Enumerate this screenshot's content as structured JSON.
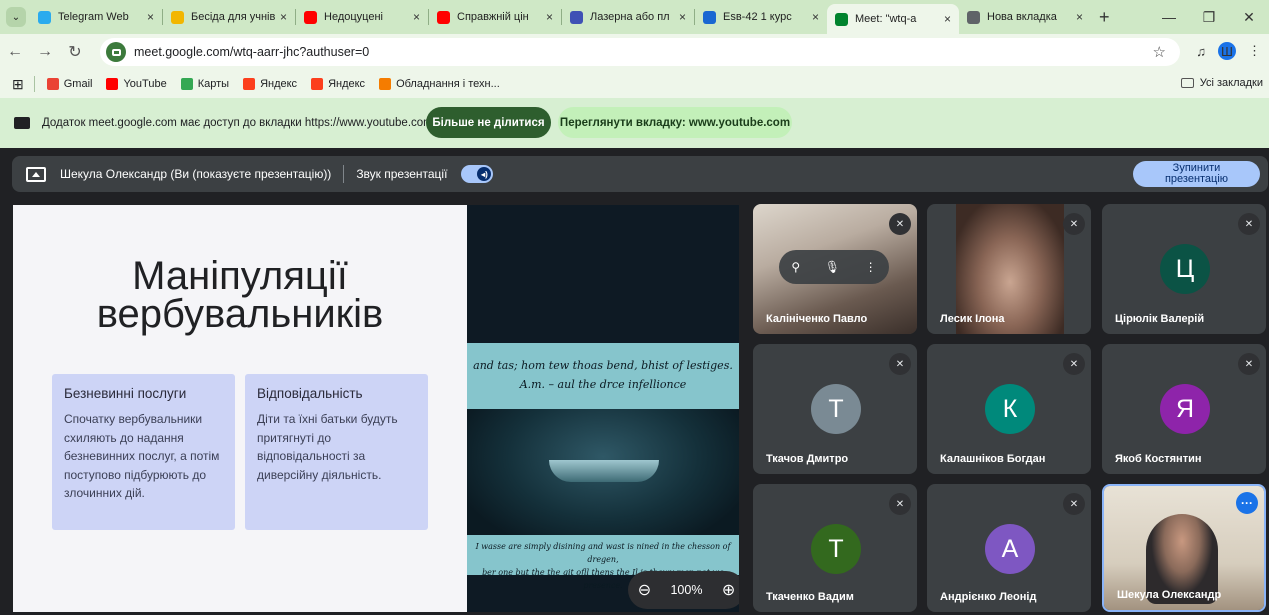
{
  "browser": {
    "tabs": [
      {
        "label": "Telegram Web",
        "color": "#2aabee"
      },
      {
        "label": "Бесіда для учнів",
        "color": "#f2b600"
      },
      {
        "label": "Недоцуцені",
        "color": "#ff0000"
      },
      {
        "label": "Справжній цін",
        "color": "#ff0000"
      },
      {
        "label": "Лазерна або пл",
        "color": "#3f51b5"
      },
      {
        "label": "Еsв-42 1 курс",
        "color": "#1967d2"
      },
      {
        "label": "Meet: \"wtq-a",
        "color": "#00832d"
      },
      {
        "label": "Нова вкладка",
        "color": "#5f6368"
      }
    ],
    "url": "meet.google.com/wtq-aarr-jhc?authuser=0",
    "profile_initial": "Ш",
    "bookmarks": [
      {
        "label": "Gmail",
        "color": "#ea4335"
      },
      {
        "label": "YouTube",
        "color": "#ff0000"
      },
      {
        "label": "Карты",
        "color": "#34a853"
      },
      {
        "label": "Яндекс",
        "color": "#fc3f1d"
      },
      {
        "label": "Яндекс",
        "color": "#fc3f1d"
      },
      {
        "label": "Обладнання і техн...",
        "color": "#f57c00"
      }
    ],
    "all_bookmarks": "Усі закладки"
  },
  "banner": {
    "text": "Додаток meet.google.com має доступ до вкладки https://www.youtube.com",
    "stop_sharing": "Більше не ділитися",
    "view_tab": "Переглянути вкладку: www.youtube.com"
  },
  "present_bar": {
    "presenter": "Шекула Олександр (Ви (показуєте презентацію))",
    "sound_label": "Звук презентації",
    "stop_label_1": "Зупинити",
    "stop_label_2": "презентацію"
  },
  "slide": {
    "title_1": "Маніпуляції",
    "title_2": "вербувальників",
    "cards": [
      {
        "heading": "Безневинні послуги",
        "body": "Спочатку вербувальники схиляють до надання безневинних послуг, а потім поступово підбурюють до злочинних дій."
      },
      {
        "heading": "Відповідальність",
        "body": "Діти та їхні батьки будуть притягнуті до відповідальності за диверсійну діяльність."
      }
    ],
    "image_text_top_1": "and tas; hom tew thoas bend, bhist of lestiges.",
    "image_text_top_2": "A.m. – aul the drce infellionce",
    "image_text_bottom_1": "I wasse are simply disining and wast is nined in the chesson of dregen,",
    "image_text_bottom_2": "ber one but the the git ofll thens the Il is thewy man not we presence.",
    "zoom_level": "100%"
  },
  "participants": [
    {
      "name": "Калініченко Павло",
      "initial": "",
      "color": ""
    },
    {
      "name": "Лесик Ілона",
      "initial": "",
      "color": ""
    },
    {
      "name": "Цірюлік Валерій",
      "initial": "Ц",
      "color": "#0b5345"
    },
    {
      "name": "Ткачов Дмитро",
      "initial": "Т",
      "color": "#7a8a94"
    },
    {
      "name": "Калашніков Богдан",
      "initial": "К",
      "color": "#00897b"
    },
    {
      "name": "Якоб Костянтин",
      "initial": "Я",
      "color": "#8e24aa"
    },
    {
      "name": "Ткаченко Вадим",
      "initial": "Т",
      "color": "#33691e"
    },
    {
      "name": "Андрієнко Леонід",
      "initial": "А",
      "color": "#7e57c2"
    },
    {
      "name": "Шекула Олександр",
      "initial": "",
      "color": ""
    }
  ]
}
